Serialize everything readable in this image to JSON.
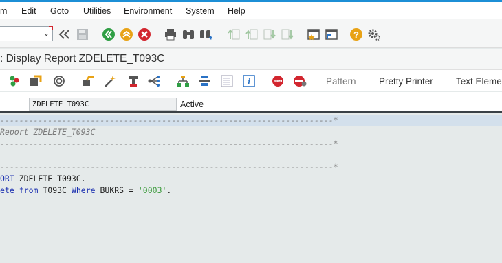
{
  "menu": {
    "items": [
      {
        "label": "m"
      },
      {
        "label": "Edit"
      },
      {
        "label": "Goto"
      },
      {
        "label": "Utilities"
      },
      {
        "label": "Environment"
      },
      {
        "label": "System"
      },
      {
        "label": "Help"
      }
    ]
  },
  "toolbar": {
    "command_field": "",
    "icons": [
      "back-icon",
      "save-icon",
      "green-back-icon",
      "exit-icon",
      "cancel-icon",
      "print-icon",
      "find-icon",
      "find-next-icon",
      "first-page-icon",
      "previous-page-icon",
      "next-page-icon",
      "last-page-icon",
      "new-session-icon",
      "shortcut-icon",
      "help-icon",
      "settings-icon"
    ]
  },
  "title": ": Display Report ZDELETE_T093C",
  "app_toolbar": {
    "pattern_label": "Pattern",
    "pretty_printer_label": "Pretty Printer",
    "text_elements_label": "Text Eleme"
  },
  "info": {
    "program_name": "ZDELETE_T093C",
    "status": "Active"
  },
  "code": {
    "lines": [
      {
        "kind": "comment",
        "text": "----------------------------------------------------------------------*"
      },
      {
        "kind": "comment",
        "text": "Report ZDELETE_T093C"
      },
      {
        "kind": "comment",
        "text": "----------------------------------------------------------------------*"
      },
      {
        "kind": "empty",
        "text": ""
      },
      {
        "kind": "comment",
        "text": "----------------------------------------------------------------------*"
      },
      {
        "kind": "report",
        "kw": "ORT",
        "rest": " ZDELETE_T093C."
      },
      {
        "kind": "delete",
        "kw1": "ete",
        "kw2": "from",
        "table": "T093C",
        "kw3": "Where",
        "field": "BUKRS = ",
        "str": "'0003'",
        "end": "."
      }
    ]
  }
}
